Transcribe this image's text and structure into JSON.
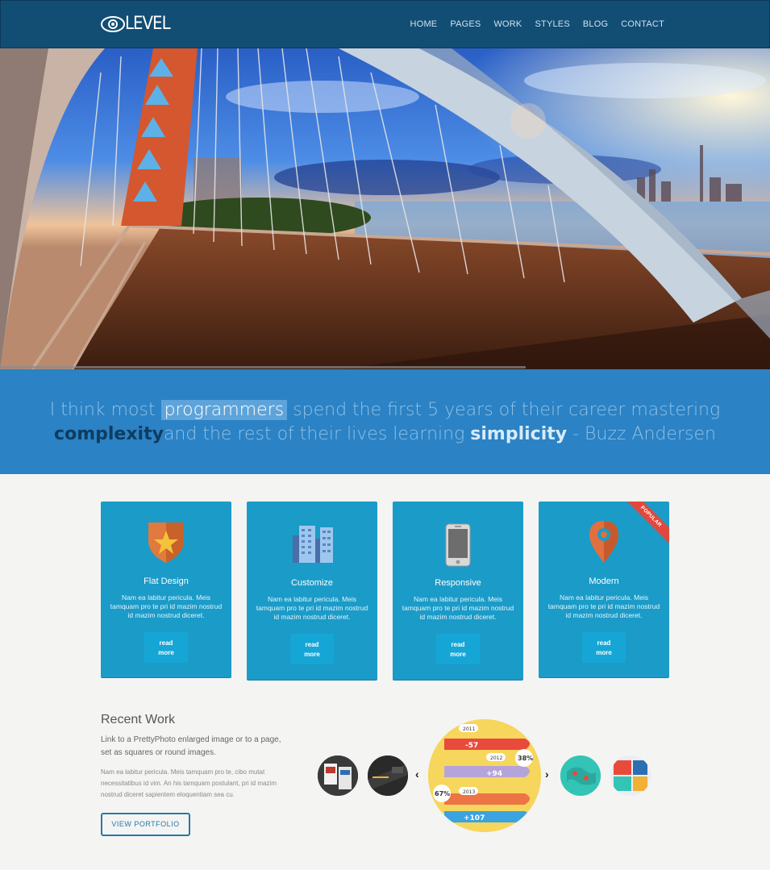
{
  "header": {
    "logo_text": "LEVEL",
    "nav": [
      "HOME",
      "PAGES",
      "WORK",
      "STYLES",
      "BLOG",
      "CONTACT"
    ]
  },
  "quote": {
    "part1": "I think most ",
    "highlight": "programmers",
    "part2": " spend the first 5 years of their career mastering",
    "strong1": "complexity",
    "part3": "and the rest of their lives learning ",
    "strong2": "simplicity",
    "part4": " - Buzz Andersen"
  },
  "cards": [
    {
      "title": "Flat Design",
      "text": "Nam ea labitur pericula. Meis tamquam pro te pri id mazim nostrud id mazim nostrud diceret.",
      "button": [
        "read",
        "more"
      ],
      "icon": "shield-star-icon"
    },
    {
      "title": "Customize",
      "text": "Nam ea labitur pericula. Meis tamquam pro te pri id mazim nostrud id mazim nostrud diceret.",
      "button": [
        "read",
        "more"
      ],
      "icon": "buildings-icon"
    },
    {
      "title": "Responsive",
      "text": "Nam ea labitur pericula. Meis tamquam pro te pri id mazim nostrud id mazim nostrud diceret.",
      "button": [
        "read",
        "more"
      ],
      "icon": "phone-icon"
    },
    {
      "title": "Modern",
      "text": "Nam ea labitur pericula. Meis tamquam pro te pri id mazim nostrud id mazim nostrud diceret.",
      "button": [
        "read",
        "more"
      ],
      "icon": "map-pin-icon",
      "ribbon": "POPULAR"
    }
  ],
  "recent_work": {
    "title": "Recent Work",
    "subtitle": "Link to a PrettyPhoto enlarged image or to a page, set as squares or round images.",
    "body": "Nam ea labitur pericula. Meis tamquam pro te, cibo mutat necessitatibus id vim. An his tamquam postulant, pri id mazim nostrud diceret sapientem eloquentiam sea cu.",
    "button": "VIEW PORTFOLIO",
    "infographic": {
      "years": [
        "2011",
        "2012",
        "2013"
      ],
      "values": [
        "-57",
        "+94",
        "+107"
      ],
      "percents": [
        "38%",
        "67%"
      ]
    }
  },
  "colors": {
    "header": "#124d74",
    "quote_band": "#2b82c4",
    "card": "#1b9bc8",
    "ribbon": "#e2483b"
  }
}
